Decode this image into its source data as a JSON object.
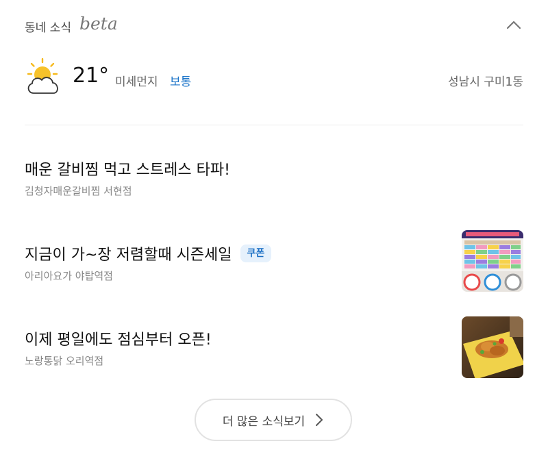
{
  "header": {
    "title": "동네 소식",
    "beta": "beta",
    "collapse_icon": "chevron-up-icon"
  },
  "weather": {
    "icon": "partly-cloudy-icon",
    "temperature": "21°",
    "dust_label": "미세먼지",
    "dust_value": "보통",
    "dust_color": "#1a73c8",
    "location": "성남시 구미1동"
  },
  "news": [
    {
      "title": "매운 갈비찜 먹고 스트레스 타파!",
      "store": "김청자매운갈비찜 서현점",
      "badge": "",
      "thumbnail": ""
    },
    {
      "title": "지금이 가~장 저렴할때 시즌세일",
      "store": "아리아요가 야탑역점",
      "badge": "쿠폰",
      "thumbnail": "schedule-poster-image"
    },
    {
      "title": "이제 평일에도 점심부터 오픈!",
      "store": "노랑통닭 오리역점",
      "badge": "",
      "thumbnail": "fried-chicken-image"
    }
  ],
  "more_button": {
    "label": "더 많은 소식보기",
    "icon": "chevron-right-icon"
  }
}
